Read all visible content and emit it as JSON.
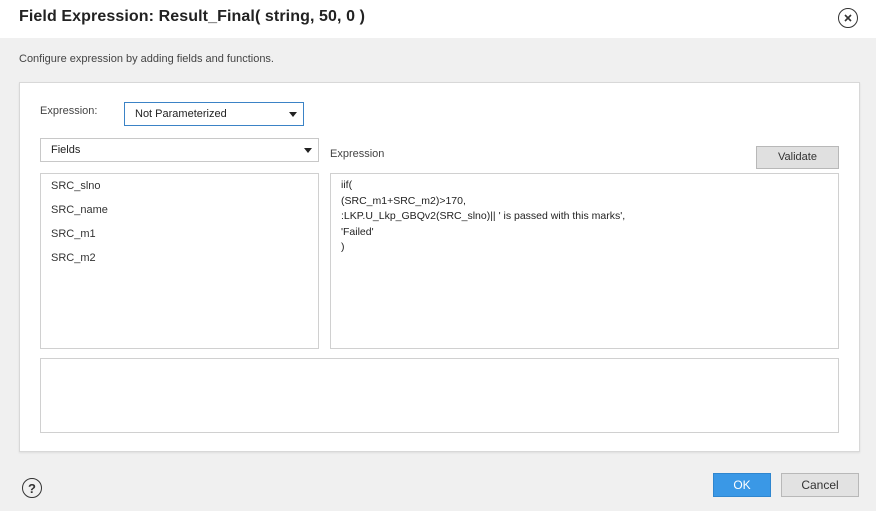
{
  "dialog": {
    "title": "Field Expression: Result_Final( string, 50, 0 )",
    "subtitle": "Configure expression by adding fields and functions."
  },
  "expression_param": {
    "label": "Expression:",
    "selected": "Not Parameterized"
  },
  "fields_dropdown": {
    "selected": "Fields"
  },
  "fields": [
    "SRC_slno",
    "SRC_name",
    "SRC_m1",
    "SRC_m2"
  ],
  "editor": {
    "label": "Expression",
    "validate_label": "Validate",
    "lines": [
      "iif(",
      "(SRC_m1+SRC_m2)>170,",
      ":LKP.U_Lkp_GBQv2(SRC_slno)|| ' is passed with this marks',",
      "'Failed'",
      ")"
    ]
  },
  "footer": {
    "help": "?",
    "ok_label": "OK",
    "cancel_label": "Cancel"
  },
  "colors": {
    "primary": "#3a98e6",
    "select_border": "#3b83c6"
  },
  "icons": {
    "close": "close-circle-icon",
    "help": "help-circle-icon",
    "dropdown": "caret-down-icon"
  }
}
